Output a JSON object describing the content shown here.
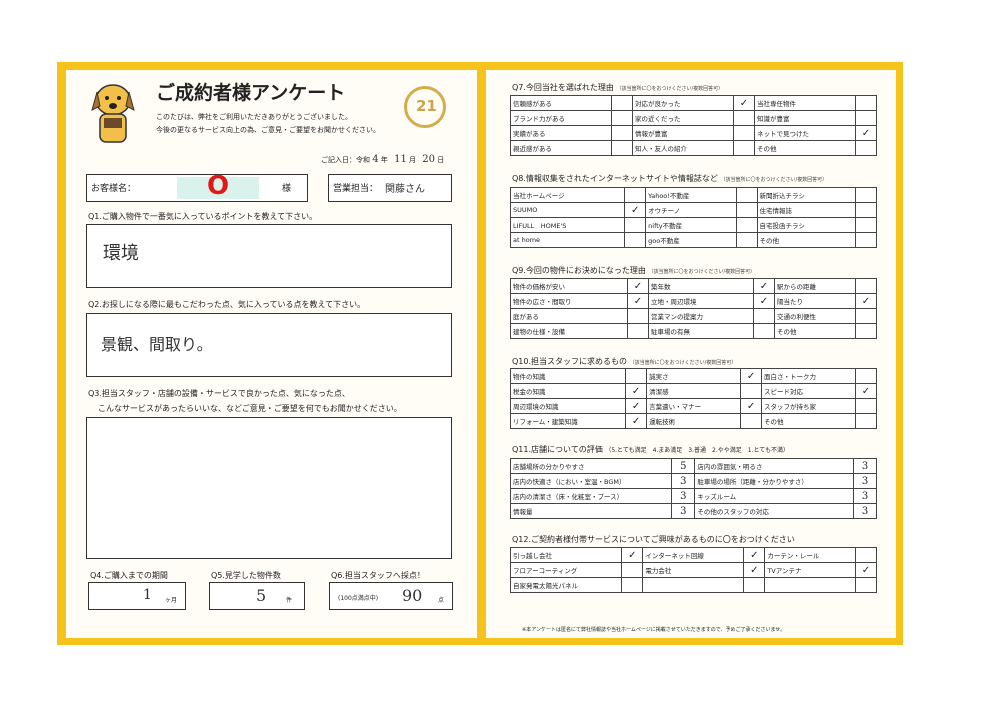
{
  "header": {
    "title": "ご成約者様アンケート",
    "intro_line1": "このたびは、弊社をご利用いただきありがとうございました。",
    "intro_line2": "今後の更なるサービス向上の為、ご意見・ご要望をお聞かせください。",
    "logo_text": "21",
    "date_label": "ご記入日：令和",
    "date_year": "4",
    "date_year_label": "年",
    "date_month": "11",
    "date_month_label": "月",
    "date_day": "20",
    "date_day_label": "日"
  },
  "customer": {
    "name_label": "お客様名：",
    "name_value": "O",
    "name_suffix": "様",
    "staff_label": "営業担当：",
    "staff_value": "関藤さん"
  },
  "q1": {
    "label": "Q1.ご購入物件で一番気に入っているポイントを教えて下さい。",
    "answer": "環境"
  },
  "q2": {
    "label": "Q2.お探しになる際に最もこだわった点、気に入っている点を教えて下さい。",
    "answer": "景観、間取り。"
  },
  "q3": {
    "label_line1": "Q3.担当スタッフ・店舗の設備・サービスで良かった点、気になった点、",
    "label_line2": "こんなサービスがあったらいいな、などご意見・ご要望を何でもお聞かせください。",
    "answer": ""
  },
  "q4": {
    "label": "Q4.ご購入までの期間",
    "value": "1",
    "unit": "ヶ月"
  },
  "q5": {
    "label": "Q5.見学した物件数",
    "value": "5",
    "unit": "件"
  },
  "q6": {
    "label": "Q6.担当スタッフへ採点！",
    "prefix": "(100点満点中)",
    "value": "90",
    "unit": "点"
  },
  "q7": {
    "label": "Q7.今回当社を選ばれた理由",
    "note": "（該当箇所に〇をおつけください/複数回答可）",
    "rows": [
      [
        {
          "t": "信頼感がある",
          "c": ""
        },
        {
          "t": "対応が良かった",
          "c": "✓"
        },
        {
          "t": "当社専任物件",
          "c": ""
        }
      ],
      [
        {
          "t": "ブランド力がある",
          "c": ""
        },
        {
          "t": "家の近くだった",
          "c": ""
        },
        {
          "t": "知識が豊富",
          "c": ""
        }
      ],
      [
        {
          "t": "実績がある",
          "c": ""
        },
        {
          "t": "情報が豊富",
          "c": ""
        },
        {
          "t": "ネットで見つけた",
          "c": "✓"
        }
      ],
      [
        {
          "t": "親近感がある",
          "c": ""
        },
        {
          "t": "知人・友人の紹介",
          "c": ""
        },
        {
          "t": "その他",
          "c": ""
        }
      ]
    ]
  },
  "q8": {
    "label": "Q8.情報収集をされたインターネットサイトや情報誌など",
    "note": "（該当箇所に〇をおつけください/複数回答可）",
    "rows": [
      [
        {
          "t": "当社ホームページ",
          "c": ""
        },
        {
          "t": "Yahoo!不動産",
          "c": ""
        },
        {
          "t": "新聞折込チラシ",
          "c": ""
        }
      ],
      [
        {
          "t": "SUUMO",
          "c": "✓"
        },
        {
          "t": "オウチーノ",
          "c": ""
        },
        {
          "t": "住宅情報誌",
          "c": ""
        }
      ],
      [
        {
          "t": "LIFULL　HOME'S",
          "c": ""
        },
        {
          "t": "nifty不動産",
          "c": ""
        },
        {
          "t": "自宅投函チラシ",
          "c": ""
        }
      ],
      [
        {
          "t": "at home",
          "c": ""
        },
        {
          "t": "goo不動産",
          "c": ""
        },
        {
          "t": "その他",
          "c": ""
        }
      ]
    ]
  },
  "q9": {
    "label": "Q9.今回の物件にお決めになった理由",
    "note": "（該当箇所に〇をおつけください/複数回答可）",
    "rows": [
      [
        {
          "t": "物件の価格が安い",
          "c": "✓"
        },
        {
          "t": "築年数",
          "c": "✓"
        },
        {
          "t": "駅からの距離",
          "c": ""
        }
      ],
      [
        {
          "t": "物件の広さ・間取り",
          "c": "✓"
        },
        {
          "t": "立地・周辺環境",
          "c": "✓"
        },
        {
          "t": "陽当たり",
          "c": "✓"
        }
      ],
      [
        {
          "t": "庭がある",
          "c": ""
        },
        {
          "t": "営業マンの提案力",
          "c": ""
        },
        {
          "t": "交通の利便性",
          "c": ""
        }
      ],
      [
        {
          "t": "建物の仕様・設備",
          "c": ""
        },
        {
          "t": "駐車場の有無",
          "c": ""
        },
        {
          "t": "その他",
          "c": ""
        }
      ]
    ]
  },
  "q10": {
    "label": "Q10.担当スタッフに求めるもの",
    "note": "（該当箇所に〇をおつけください/複数回答可）",
    "rows": [
      [
        {
          "t": "物件の知識",
          "c": ""
        },
        {
          "t": "誠実さ",
          "c": "✓"
        },
        {
          "t": "面白さ・トーク力",
          "c": ""
        }
      ],
      [
        {
          "t": "税金の知識",
          "c": "✓"
        },
        {
          "t": "清潔感",
          "c": ""
        },
        {
          "t": "スピード対応",
          "c": "✓"
        }
      ],
      [
        {
          "t": "周辺環境の知識",
          "c": "✓"
        },
        {
          "t": "言葉遣い・マナー",
          "c": "✓"
        },
        {
          "t": "スタッフが持ち家",
          "c": ""
        }
      ],
      [
        {
          "t": "リフォーム・建築知識",
          "c": "✓"
        },
        {
          "t": "運転技術",
          "c": ""
        },
        {
          "t": "その他",
          "c": ""
        }
      ]
    ]
  },
  "q11": {
    "label": "Q11.店舗についての評価",
    "scale": "（5.とても満足　4.まあ満足　3.普通　2.やや満足　1.とても不満）",
    "rows": [
      [
        {
          "t": "店舗場所の分かりやすさ",
          "s": "5"
        },
        {
          "t": "店内の雰囲気・明るさ",
          "s": "3"
        }
      ],
      [
        {
          "t": "店内の快適さ（におい・室温・BGM）",
          "s": "3"
        },
        {
          "t": "駐車場の場所（距離・分かりやすさ）",
          "s": "3"
        }
      ],
      [
        {
          "t": "店内の清潔さ（床・化粧室・ブース）",
          "s": "3"
        },
        {
          "t": "キッズルーム",
          "s": "3"
        }
      ],
      [
        {
          "t": "情報量",
          "s": "3"
        },
        {
          "t": "その他のスタッフの対応",
          "s": "3"
        }
      ]
    ]
  },
  "q12": {
    "label": "Q12.ご契約者様付帯サービスについてご興味があるものに〇をおつけください",
    "rows": [
      [
        {
          "t": "引っ越し会社",
          "c": "✓"
        },
        {
          "t": "インターネット回線",
          "c": "✓"
        },
        {
          "t": "カーテン・レール",
          "c": ""
        }
      ],
      [
        {
          "t": "フロアーコーティング",
          "c": ""
        },
        {
          "t": "電力会社",
          "c": "✓"
        },
        {
          "t": "TVアンテナ",
          "c": "✓"
        }
      ],
      [
        {
          "t": "自家発電太陽光パネル",
          "c": ""
        },
        {
          "t": "",
          "c": ""
        },
        {
          "t": "",
          "c": ""
        }
      ]
    ]
  },
  "footer": {
    "note": "※本アンケートは匿名にて弊社情報誌や当社ホームページに掲載させていただきますので、予めご了承くださいませ。"
  }
}
